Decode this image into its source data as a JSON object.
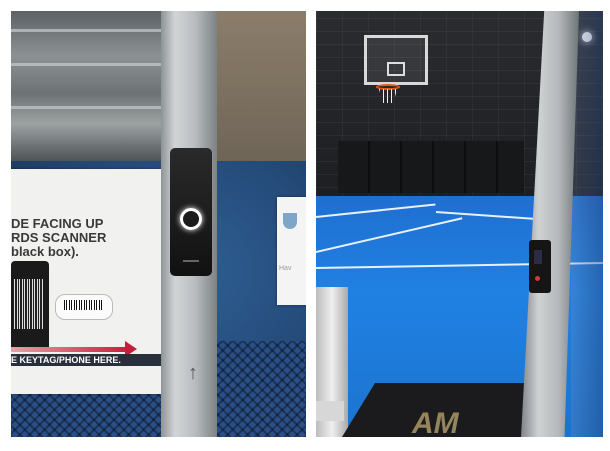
{
  "left_photo": {
    "sign": {
      "line1": "DE FACING UP",
      "line2": "RDS SCANNER",
      "line3": "black box).",
      "footer": "E KEYTAG/PHONE HERE."
    },
    "door_arrow": "↑",
    "door_sign_text": "Hav"
  },
  "right_photo": {
    "mat_logo": "AM"
  },
  "colors": {
    "court_blue": "#2081e3",
    "reader_ring": "#ffffff",
    "reader_led": "#d23a3a"
  }
}
